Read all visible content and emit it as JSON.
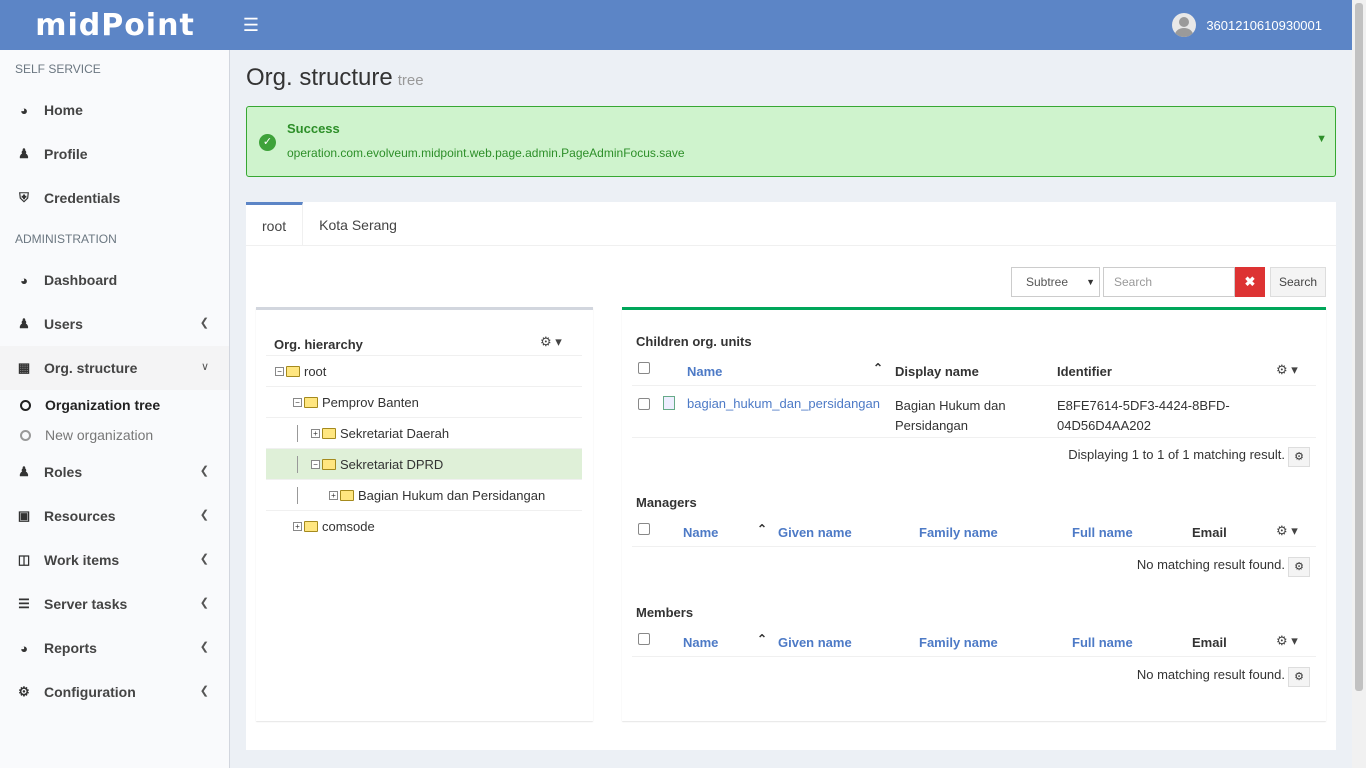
{
  "header": {
    "logo": "midPoint",
    "user": "3601210610930001"
  },
  "sidebar": {
    "self_service_header": "SELF SERVICE",
    "self_service": [
      {
        "label": "Home"
      },
      {
        "label": "Profile"
      },
      {
        "label": "Credentials"
      }
    ],
    "admin_header": "ADMINISTRATION",
    "admin": [
      {
        "label": "Dashboard"
      },
      {
        "label": "Users"
      },
      {
        "label": "Org. structure"
      },
      {
        "label": "Roles"
      },
      {
        "label": "Resources"
      },
      {
        "label": "Work items"
      },
      {
        "label": "Server tasks"
      },
      {
        "label": "Reports"
      },
      {
        "label": "Configuration"
      }
    ],
    "org_sub": [
      {
        "label": "Organization tree"
      },
      {
        "label": "New organization"
      }
    ]
  },
  "page": {
    "title": "Org. structure",
    "subtitle": "tree"
  },
  "alert": {
    "title": "Success",
    "message": "operation.com.evolveum.midpoint.web.page.admin.PageAdminFocus.save",
    "color": "#37a732"
  },
  "tabs": [
    {
      "label": "root"
    },
    {
      "label": "Kota Serang"
    }
  ],
  "search": {
    "scope": "Subtree",
    "placeholder": "Search",
    "button": "Search"
  },
  "tree": {
    "title": "Org. hierarchy",
    "nodes": [
      {
        "label": "root"
      },
      {
        "label": "Pemprov Banten"
      },
      {
        "label": "Sekretariat Daerah"
      },
      {
        "label": "Sekretariat DPRD"
      },
      {
        "label": "Bagian Hukum dan Persidangan"
      },
      {
        "label": "comsode"
      }
    ]
  },
  "children": {
    "title": "Children org. units",
    "columns": {
      "name": "Name",
      "display_name": "Display name",
      "identifier": "Identifier"
    },
    "rows": [
      {
        "name": "bagian_hukum_dan_persidangan",
        "display_name_1": "Bagian Hukum dan",
        "display_name_2": "Persidangan",
        "identifier_1": "E8FE7614-5DF3-4424-8BFD-",
        "identifier_2": "04D56D4AA202"
      }
    ],
    "footer": "Displaying 1 to 1 of 1 matching result."
  },
  "managers": {
    "title": "Managers",
    "columns": {
      "name": "Name",
      "given": "Given name",
      "family": "Family name",
      "full": "Full name",
      "email": "Email"
    },
    "footer": "No matching result found."
  },
  "members": {
    "title": "Members",
    "columns": {
      "name": "Name",
      "given": "Given name",
      "family": "Family name",
      "full": "Full name",
      "email": "Email"
    },
    "footer": "No matching result found."
  },
  "colors": {
    "header": "#5c85c6",
    "accent_green": "#00a65a",
    "alert_bg": "#cff3cd",
    "clear_button": "#dd3333"
  }
}
